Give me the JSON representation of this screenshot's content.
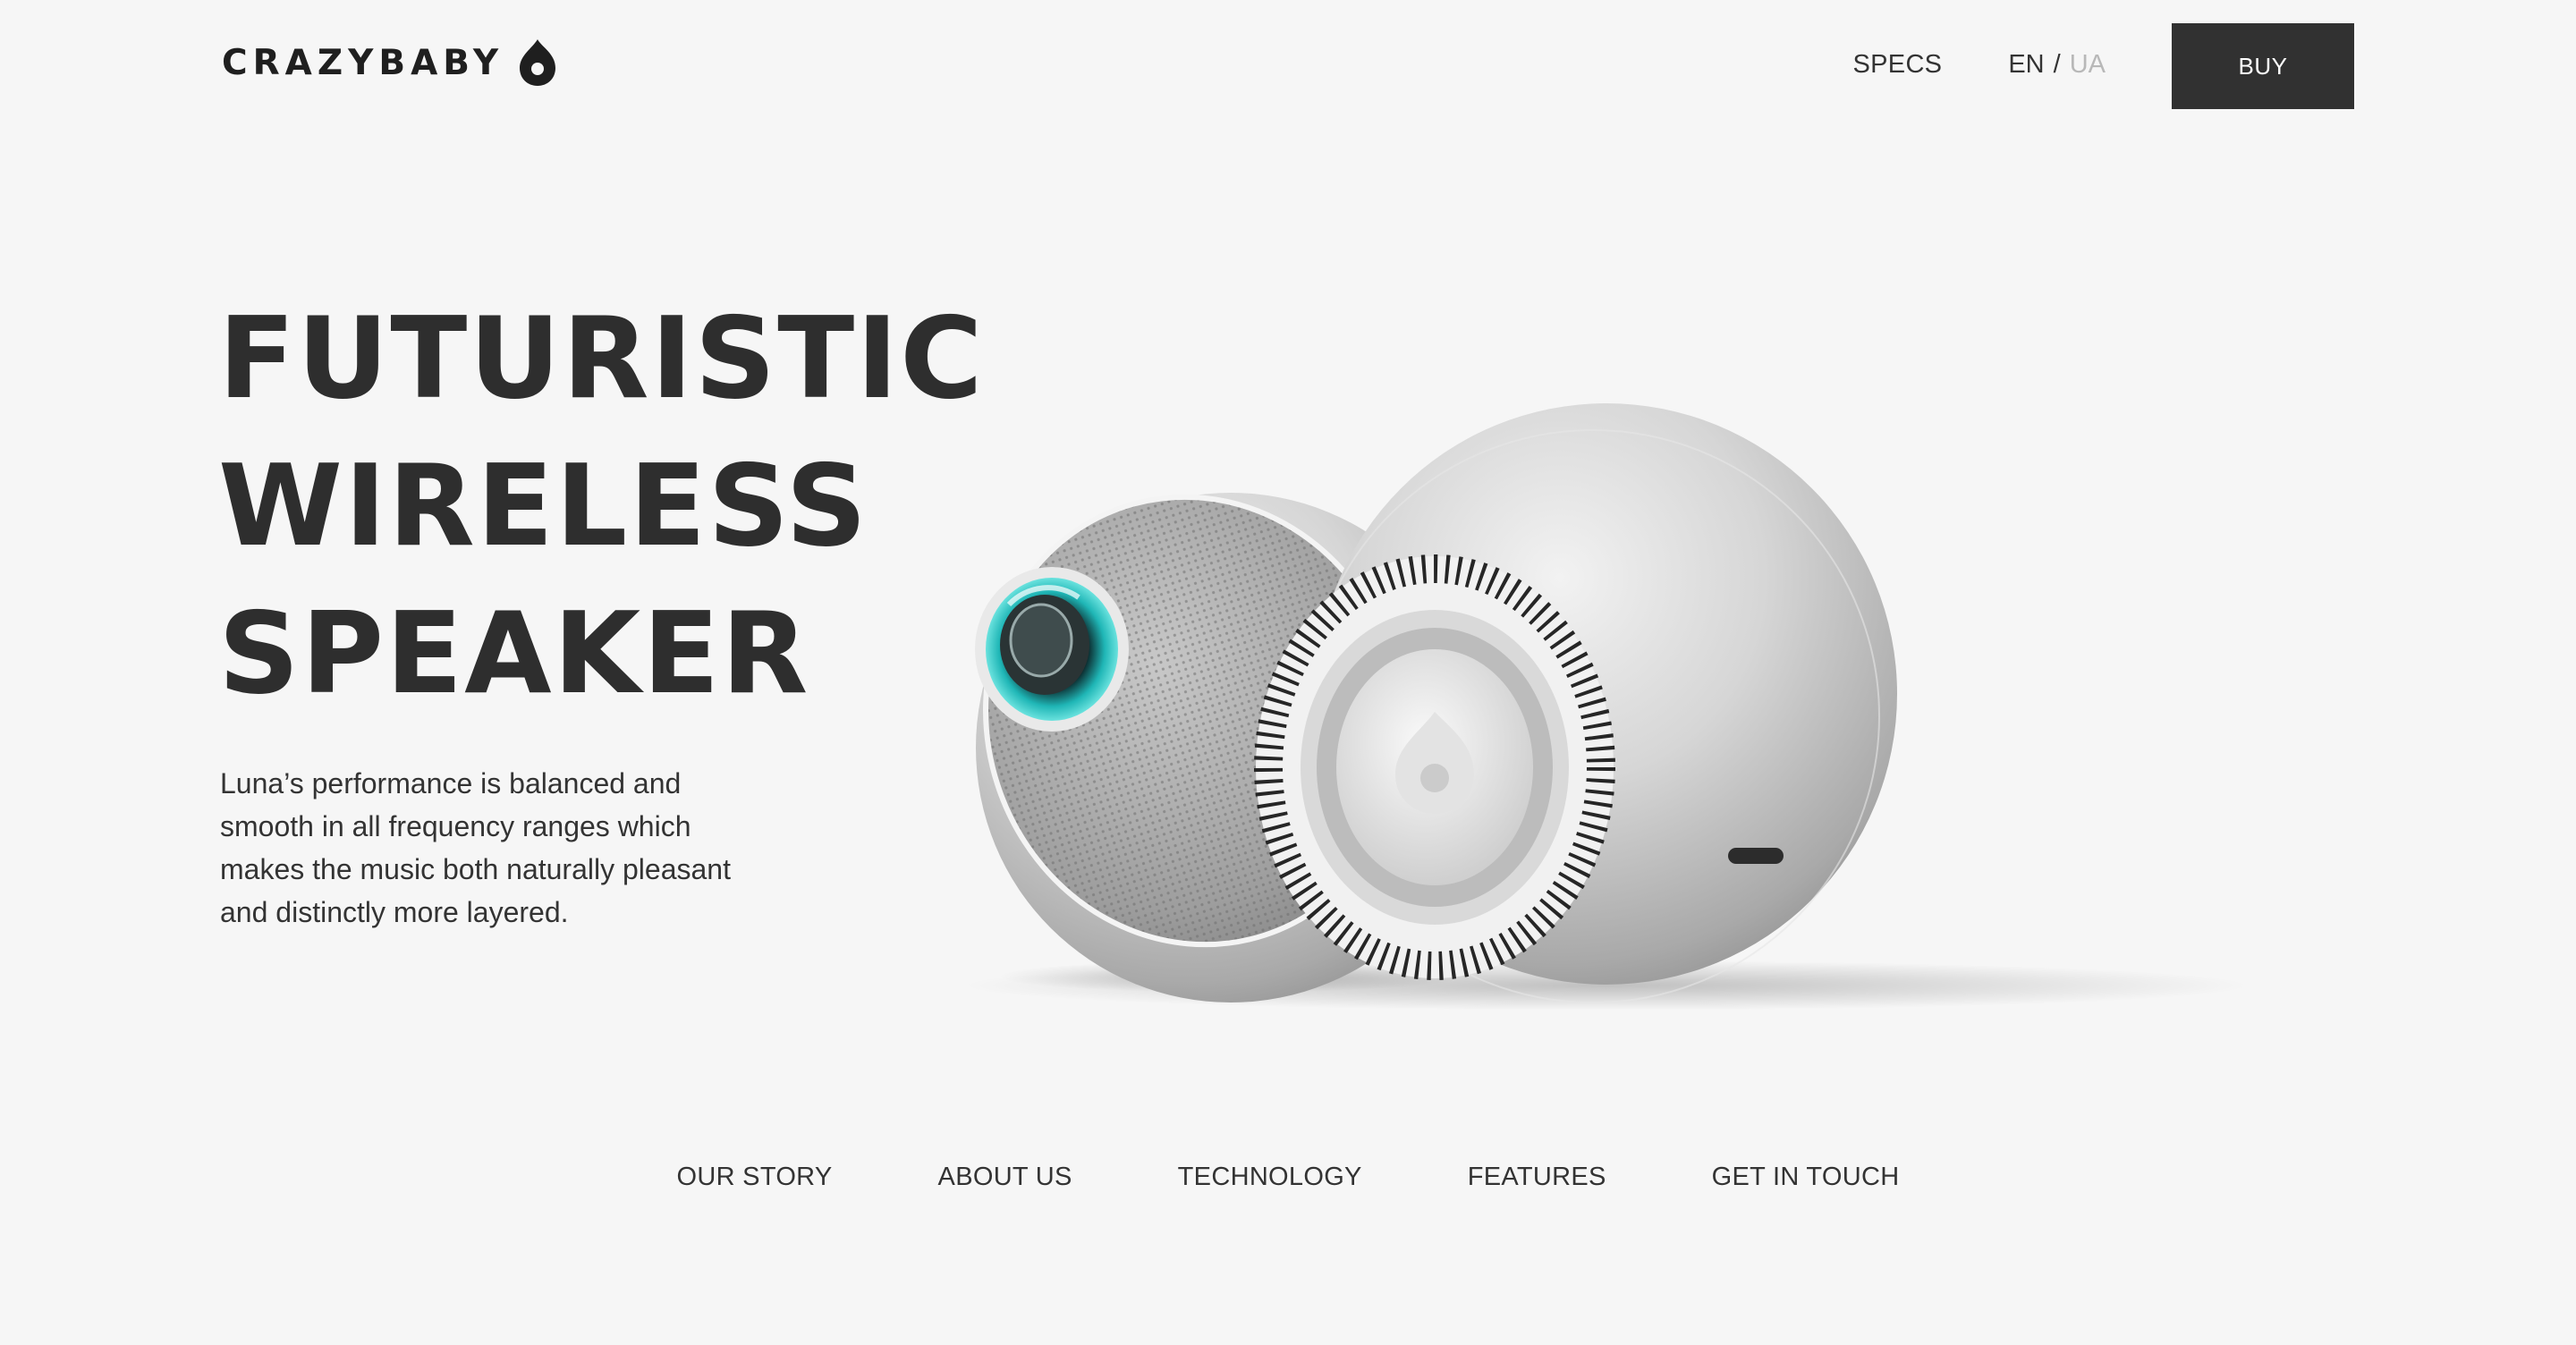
{
  "brand": {
    "name": "CRAZYBABY",
    "logo_icon": "drop-logo-icon"
  },
  "header": {
    "specs_label": "SPECS",
    "lang_current": "EN",
    "lang_separator": "/",
    "lang_other": "UA",
    "buy_label": "BUY"
  },
  "hero": {
    "title_lines": [
      "FUTURISTIC",
      "WIRELESS",
      "SPEAKER"
    ],
    "description": "Luna’s performance is balanced and smooth in all frequency ranges which makes the music both naturally pleasant and distinctly more layered."
  },
  "footer_nav": {
    "items": [
      {
        "label": "OUR STORY"
      },
      {
        "label": "ABOUT US"
      },
      {
        "label": "TECHNOLOGY"
      },
      {
        "label": "FEATURES"
      },
      {
        "label": "GET IN TOUCH"
      }
    ]
  },
  "colors": {
    "background": "#f6f6f6",
    "text": "#333333",
    "button": "#313131",
    "muted": "#b8b8b8",
    "accent": "#35c8c8"
  }
}
